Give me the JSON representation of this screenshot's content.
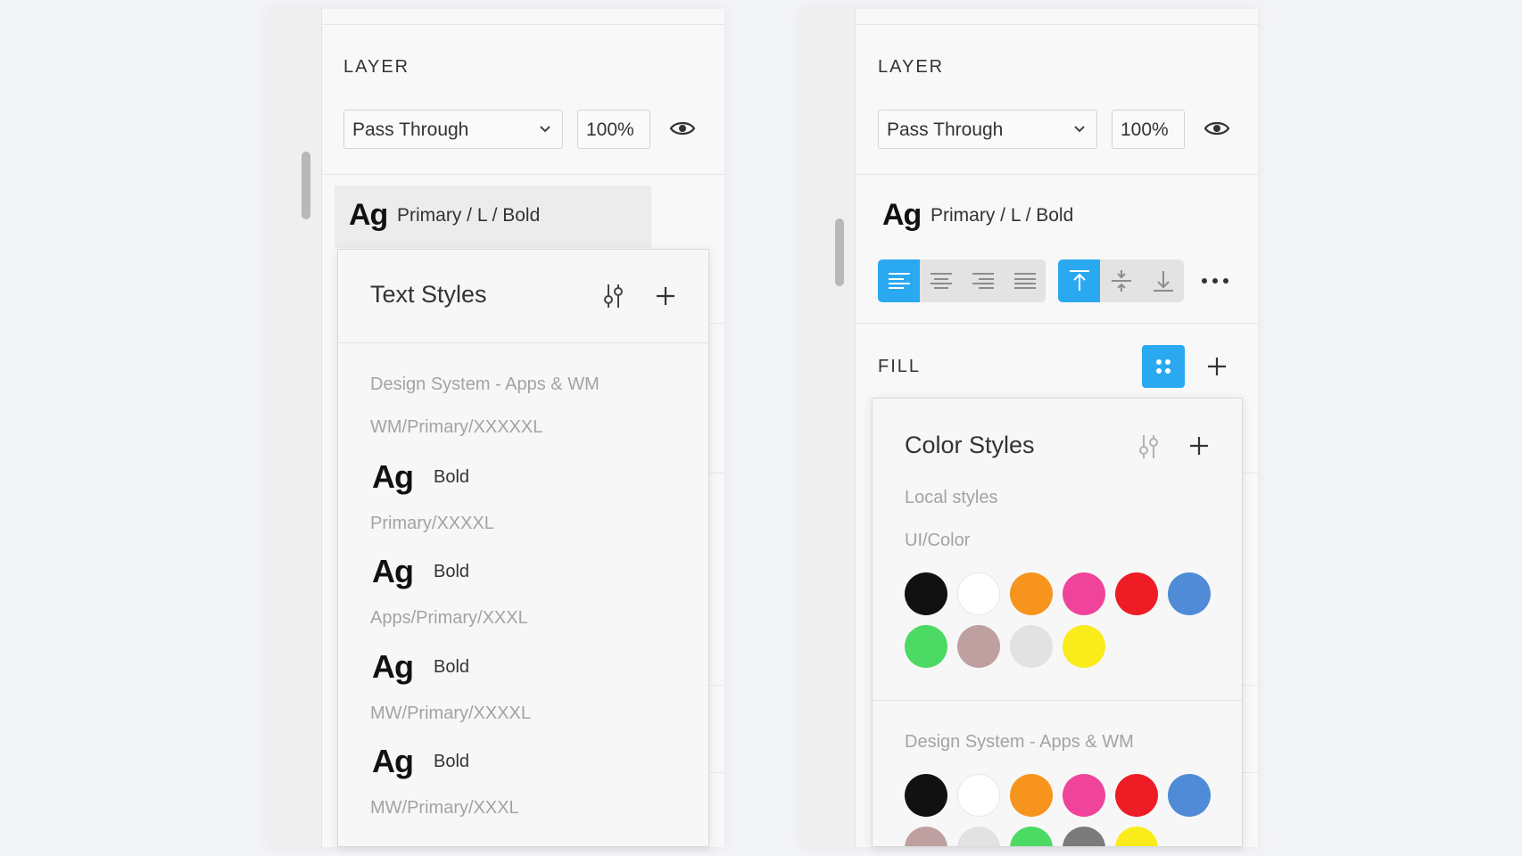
{
  "left_panel": {
    "layer_title": "LAYER",
    "blend_mode": "Pass Through",
    "opacity": "100%",
    "text_style": {
      "preview": "Ag",
      "name": "Primary / L / Bold"
    },
    "text_styles_popup": {
      "title": "Text Styles",
      "groups": [
        {
          "name": "Design System - Apps & WM",
          "subgroup": "WM/Primary/XXXXXL",
          "items": [
            {
              "preview": "Ag",
              "weight": "Bold",
              "name": "Primary/XXXXL"
            },
            {
              "preview": "Ag",
              "weight": "Bold",
              "name": "Apps/Primary/XXXL"
            },
            {
              "preview": "Ag",
              "weight": "Bold",
              "name": "MW/Primary/XXXXL"
            },
            {
              "preview": "Ag",
              "weight": "Bold",
              "name": "MW/Primary/XXXL"
            }
          ]
        }
      ]
    }
  },
  "right_panel": {
    "layer_title": "LAYER",
    "blend_mode": "Pass Through",
    "opacity": "100%",
    "text_style": {
      "preview": "Ag",
      "name": "Primary / L / Bold"
    },
    "alignment": {
      "horizontal": [
        "align-left",
        "align-center",
        "align-right",
        "justify"
      ],
      "horizontal_active": "align-left",
      "vertical": [
        "align-top",
        "align-middle",
        "align-bottom"
      ],
      "vertical_active": "align-top"
    },
    "fill_title": "FILL",
    "color_styles_popup": {
      "title": "Color Styles",
      "local_label": "Local styles",
      "local_group": "UI/Color",
      "local_colors": [
        "#111111",
        "#ffffff",
        "#f7941d",
        "#f0449b",
        "#ee1c24",
        "#4f8bd6",
        "#4cd964",
        "#bfa0a0",
        "#e2e2e2",
        "#f9ec1a"
      ],
      "library_label": "Design System - Apps & WM",
      "library_colors": [
        "#111111",
        "#ffffff",
        "#f7941d",
        "#f0449b",
        "#ee1c24",
        "#4f8bd6",
        "#bfa0a0",
        "#e2e2e2",
        "#4cd964",
        "#7a7a7a",
        "#f9ec1a"
      ]
    }
  },
  "colors": {
    "accent": "#2aa9f0",
    "panel_bg": "#f8f8f8",
    "page_bg": "#f3f4f7"
  }
}
